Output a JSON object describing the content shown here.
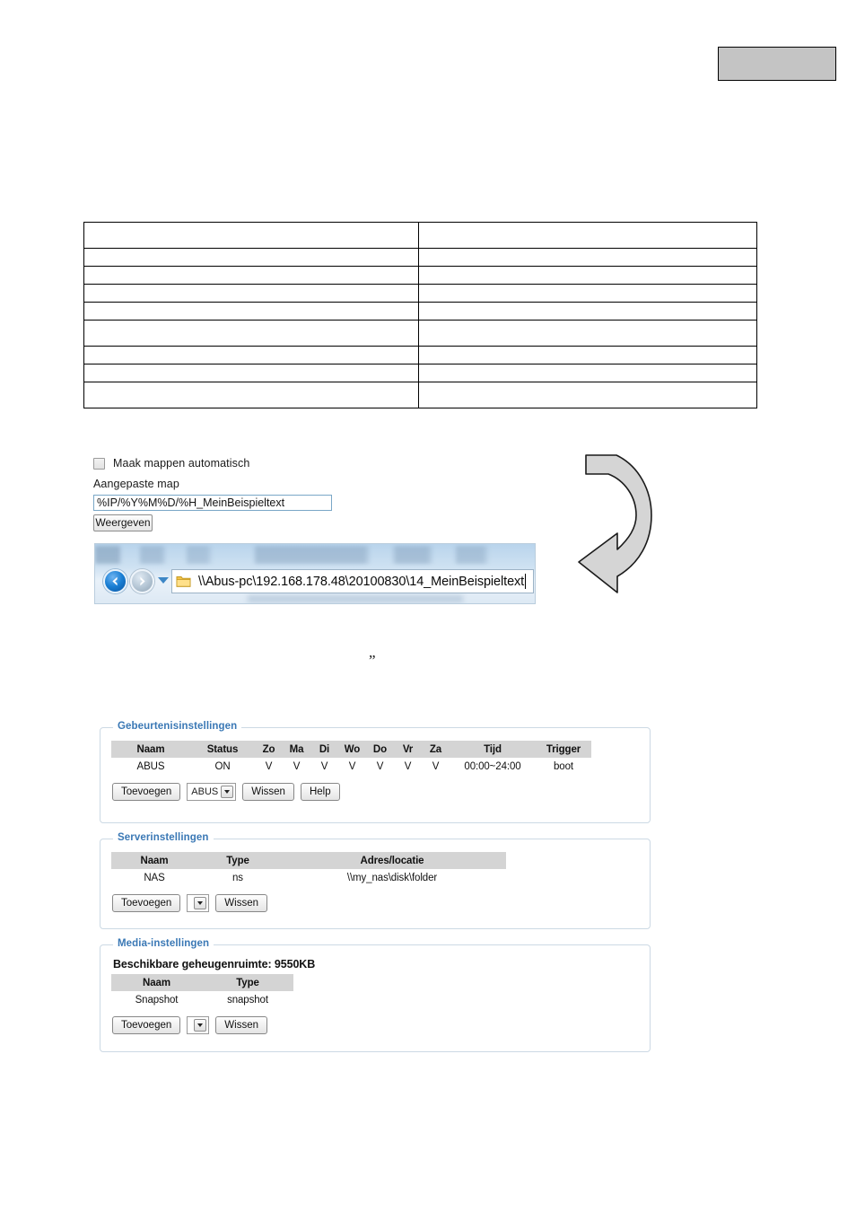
{
  "header": {
    "placeholder_box_label": ""
  },
  "spec_table": {
    "rows": [
      {
        "left": "",
        "right": ""
      },
      {
        "left": "",
        "right": ""
      },
      {
        "left": "",
        "right": ""
      },
      {
        "left": "",
        "right": ""
      },
      {
        "left": "",
        "right": ""
      },
      {
        "left": "",
        "right": ""
      },
      {
        "left": "",
        "right": ""
      },
      {
        "left": "",
        "right": ""
      },
      {
        "left": "",
        "right": ""
      }
    ]
  },
  "folder_panel": {
    "auto_create_checkbox_label": "Maak mappen automatisch",
    "custom_folder_label": "Aangepaste map",
    "custom_folder_value": "%IP/%Y%M%D/%H_MeinBeispieltext",
    "custom_folder_placeholder": "",
    "display_button_label": "Weergeven"
  },
  "explorer": {
    "address_value": "\\\\Abus-pc\\192.168.178.48\\20100830\\14_MeinBeispieltext",
    "back_icon": "arrow-left-icon",
    "forward_icon": "arrow-right-icon",
    "dropdown_icon": "chevron-down-icon",
    "folder_icon": "folder-icon"
  },
  "annotation": {
    "curved_arrow_icon": "curved-arrow-icon",
    "stray_quote": "”"
  },
  "event_settings": {
    "legend": "Gebeurtenisinstellingen",
    "columns": [
      "Naam",
      "Status",
      "Zo",
      "Ma",
      "Di",
      "Wo",
      "Do",
      "Vr",
      "Za",
      "Tijd",
      "Trigger"
    ],
    "rows": [
      {
        "naam": "ABUS",
        "status": "ON",
        "zo": "V",
        "ma": "V",
        "di": "V",
        "wo": "V",
        "do": "V",
        "vr": "V",
        "za": "V",
        "tijd": "00:00~24:00",
        "trigger": "boot"
      }
    ],
    "buttons": {
      "add": "Toevoegen",
      "select_value": "ABUS",
      "delete": "Wissen",
      "help": "Help"
    }
  },
  "server_settings": {
    "legend": "Serverinstellingen",
    "columns": [
      "Naam",
      "Type",
      "Adres/locatie"
    ],
    "rows": [
      {
        "naam": "NAS",
        "type": "ns",
        "adres": "\\\\my_nas\\disk\\folder"
      }
    ],
    "buttons": {
      "add": "Toevoegen",
      "select_value": "",
      "delete": "Wissen"
    }
  },
  "media_settings": {
    "legend": "Media-instellingen",
    "memory_line": "Beschikbare geheugenruimte: 9550KB",
    "columns": [
      "Naam",
      "Type"
    ],
    "rows": [
      {
        "naam": "Snapshot",
        "type": "snapshot"
      }
    ],
    "buttons": {
      "add": "Toevoegen",
      "select_value": "",
      "delete": "Wissen"
    }
  },
  "colors": {
    "link_blue": "#2f7ec4",
    "legend_blue": "#3a78b5",
    "table_header_grey": "#d4d4d4",
    "panel_border": "#ccd9e4",
    "placeholder_grey": "#c4c4c4"
  }
}
